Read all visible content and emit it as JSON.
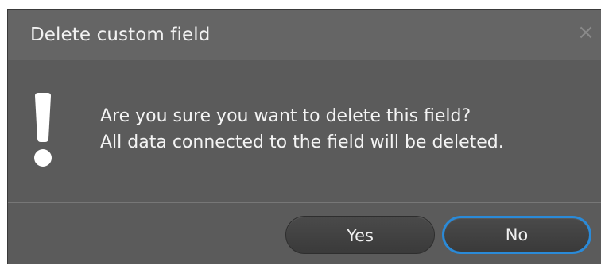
{
  "dialog": {
    "title": "Delete custom field",
    "close_glyph": "×",
    "icon": "exclamation-icon",
    "message_line1": "Are you sure you want to delete this field?",
    "message_line2": "All data connected to the field will be deleted.",
    "buttons": {
      "yes_label": "Yes",
      "no_label": "No"
    },
    "focused_button": "No",
    "colors": {
      "background": "#5b5b5b",
      "titlebar": "#656565",
      "button": "#424242",
      "focus_ring": "#2a8ad8",
      "text": "#f4f4f4"
    }
  }
}
